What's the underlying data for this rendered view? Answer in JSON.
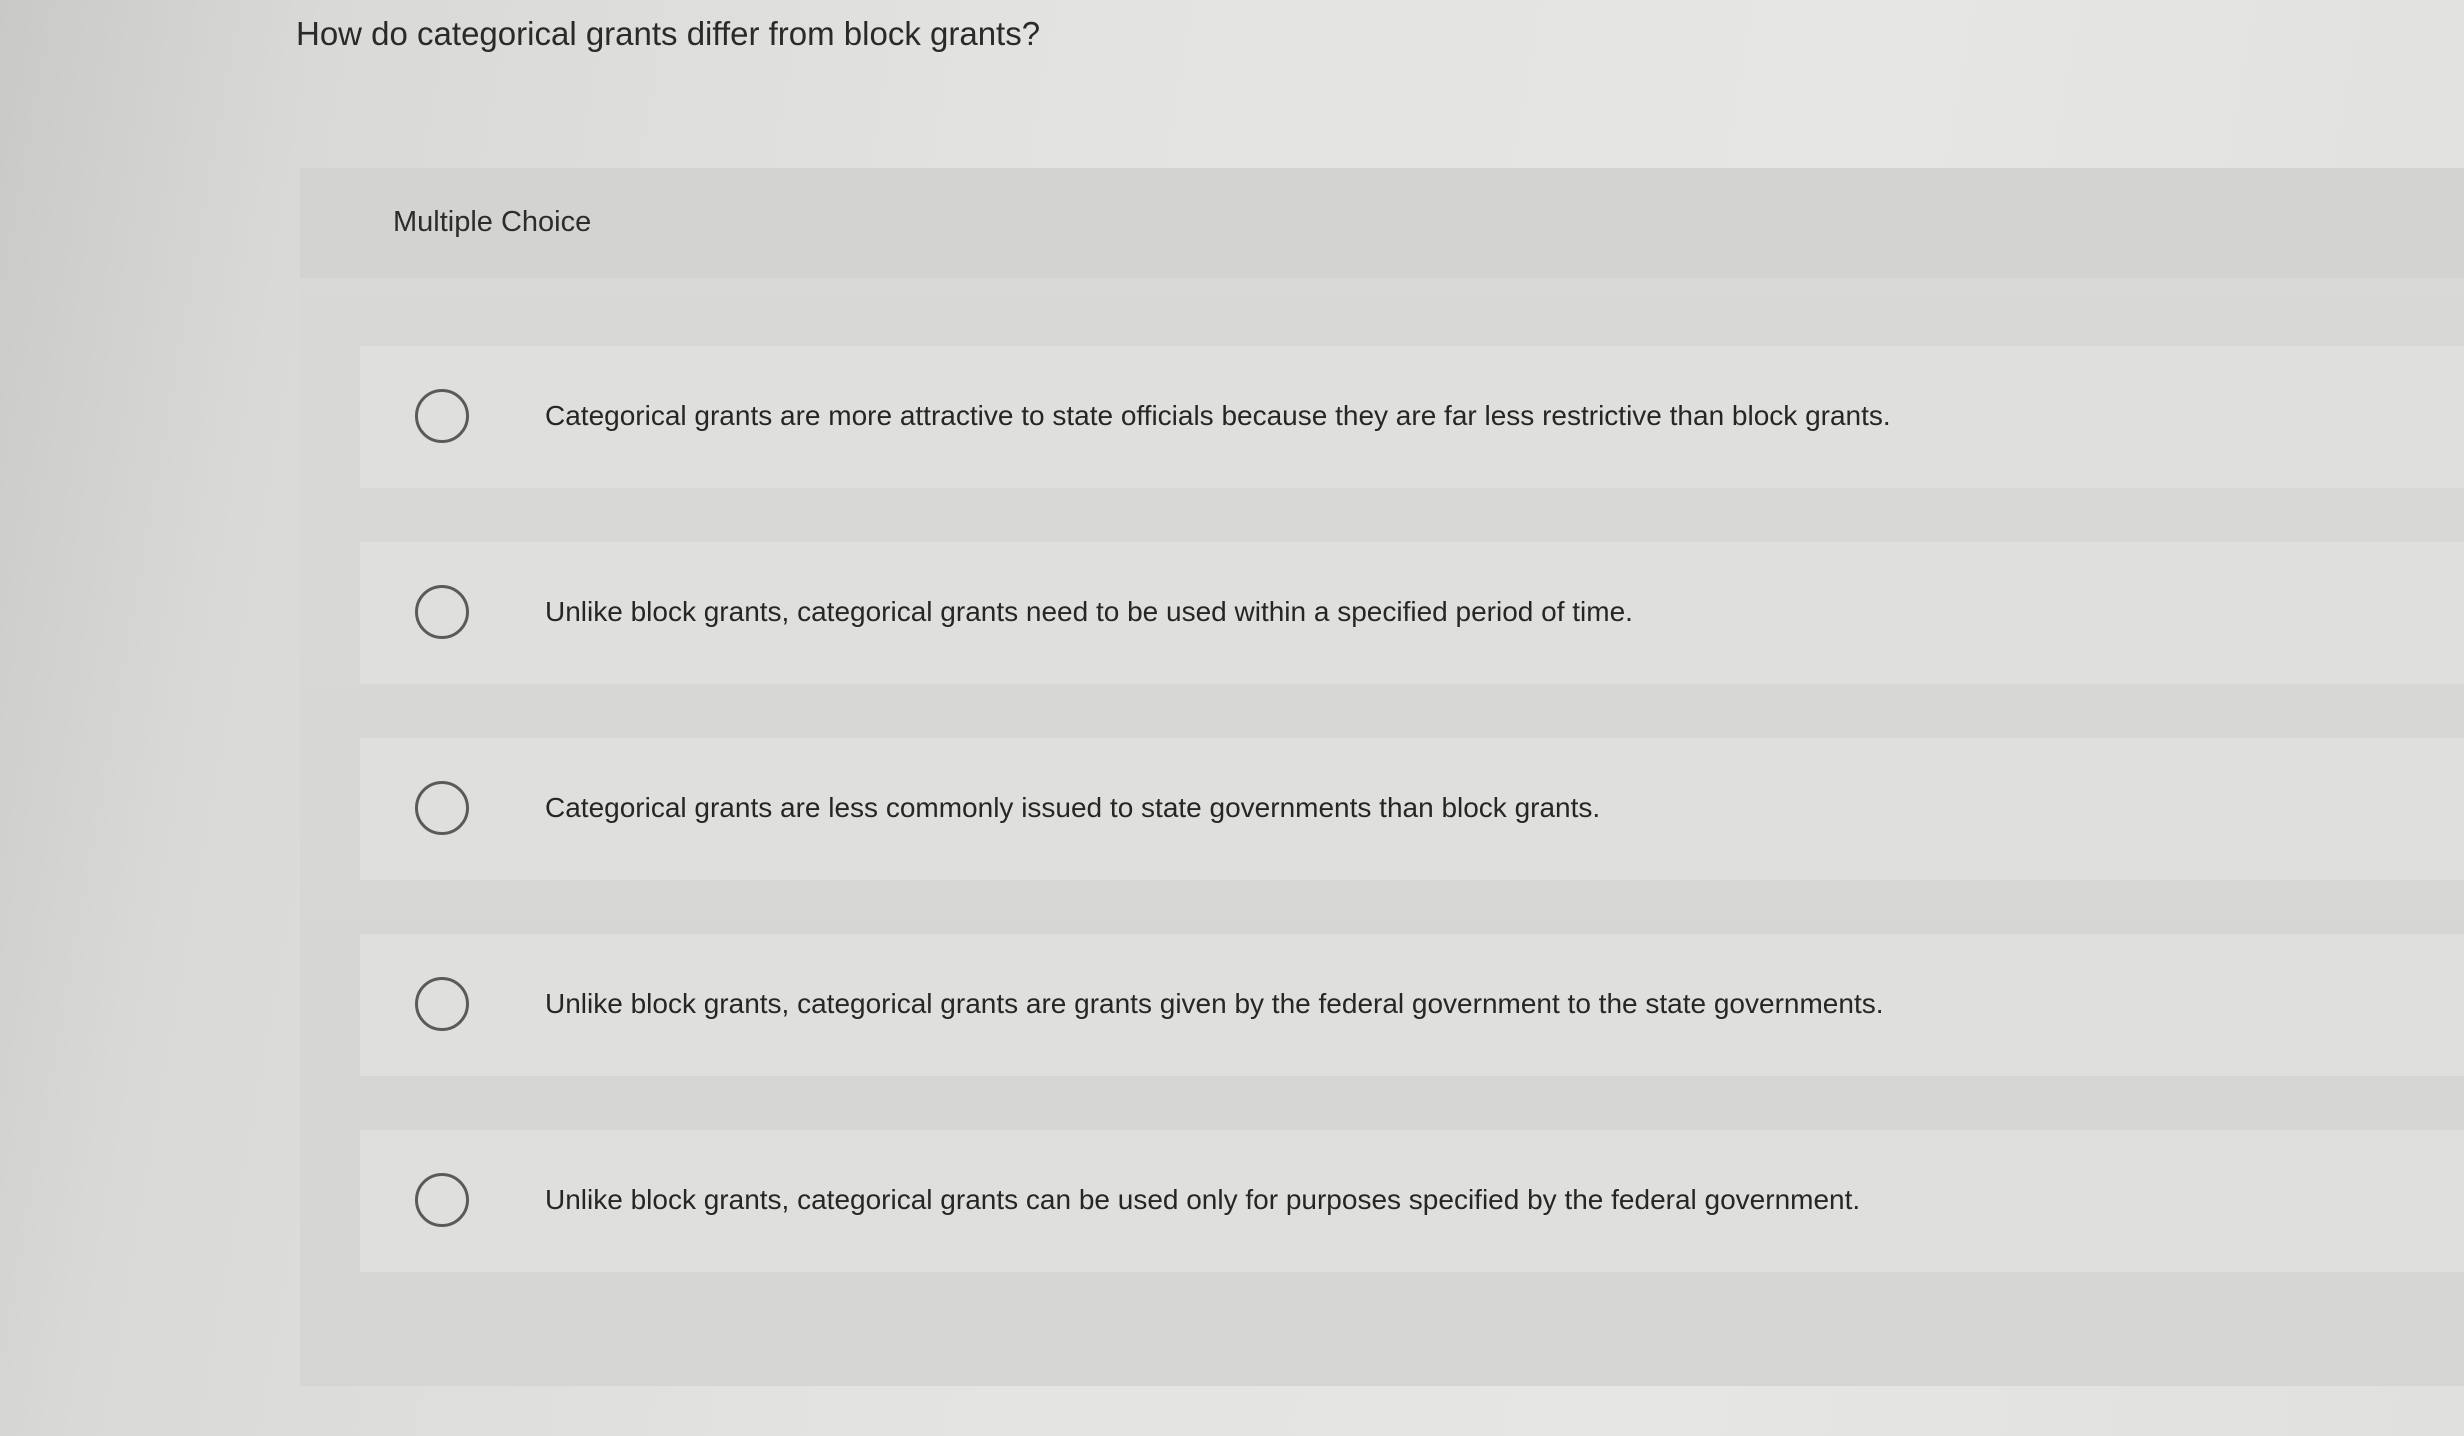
{
  "question": {
    "text": "How do categorical grants differ from block grants?"
  },
  "panel": {
    "type_label": "Multiple Choice"
  },
  "options": [
    {
      "label": "Categorical grants are more attractive to state officials because they are far less restrictive than block grants.",
      "selected": false
    },
    {
      "label": "Unlike block grants, categorical grants need to be used within a specified period of time.",
      "selected": false
    },
    {
      "label": "Categorical grants are less commonly issued to state governments than block grants.",
      "selected": false
    },
    {
      "label": "Unlike block grants, categorical grants are grants given by the federal government to the state governments.",
      "selected": false
    },
    {
      "label": "Unlike block grants, categorical grants can be used only for purposes specified by the federal government.",
      "selected": false
    }
  ]
}
